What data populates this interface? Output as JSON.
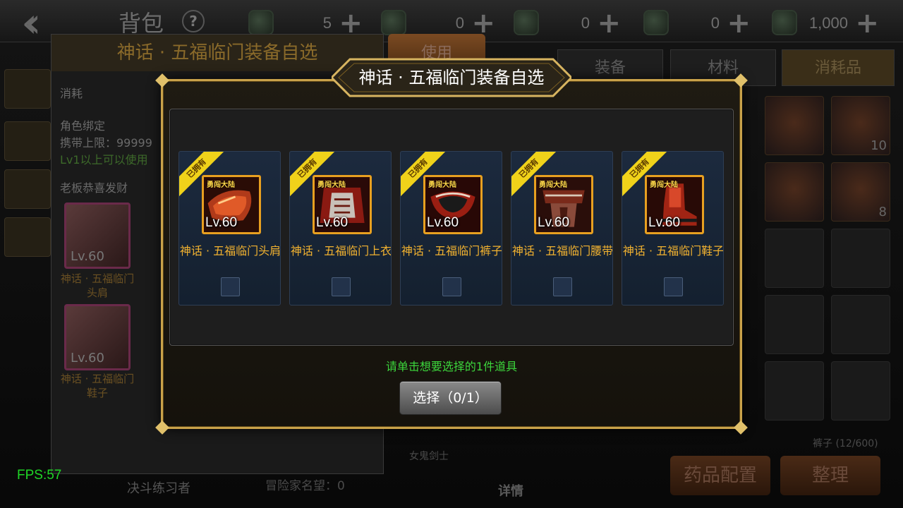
{
  "header": {
    "title": "背包",
    "back_icon": "double-chevron-left-icon",
    "help_label": "?",
    "currencies": [
      {
        "icon": "coin-medal-icon",
        "value": "5"
      },
      {
        "icon": "green-crystal-icon",
        "value": "0"
      },
      {
        "icon": "teal-potion-icon",
        "value": "0"
      },
      {
        "icon": "gold-coin-icon",
        "value": "0"
      },
      {
        "icon": "gold-pile-icon",
        "value": "1,000"
      }
    ],
    "plus_label": "+"
  },
  "detail_panel": {
    "title": "神话 · 五福临门装备自选",
    "type": "消耗",
    "bind": "角色绑定",
    "carry_limit": "携带上限：99999",
    "level_req": "Lv1以上可以使用",
    "desc": "老板恭喜发财",
    "items": [
      {
        "lv": "Lv.60",
        "name": "神话 · 五福临门头肩"
      },
      {
        "lv": "Lv.60",
        "name": "神话 · 五福临门鞋子"
      }
    ],
    "use_label": "使用"
  },
  "inventory": {
    "tabs": [
      {
        "label": "装备",
        "active": false
      },
      {
        "label": "材料",
        "active": false
      },
      {
        "label": "消耗品",
        "active": true
      }
    ],
    "counts": [
      "10",
      "8"
    ],
    "slot_text": "裤子 (12/600)",
    "char_label": "女鬼剑士",
    "detail_label": "详情",
    "fame_label": "冒险家名望：0",
    "duel_label": "决斗练习者",
    "med_config_label": "药品配置",
    "sort_label": "整理"
  },
  "fps": "FPS:57",
  "modal": {
    "title": "神话 · 五福临门装备自选",
    "ribbon_label": "已拥有",
    "brand_label": "勇闯大陆",
    "items": [
      {
        "lv": "Lv.60",
        "name": "神话 · 五福临门头肩",
        "checked": false,
        "art": "shoulder"
      },
      {
        "lv": "Lv.60",
        "name": "神话 · 五福临门上衣",
        "checked": false,
        "art": "top"
      },
      {
        "lv": "Lv.60",
        "name": "神话 · 五福临门裤子",
        "checked": false,
        "art": "pants"
      },
      {
        "lv": "Lv.60",
        "name": "神话 · 五福临门腰带",
        "checked": false,
        "art": "belt"
      },
      {
        "lv": "Lv.60",
        "name": "神话 · 五福临门鞋子",
        "checked": false,
        "art": "shoes"
      }
    ],
    "hint": "请单击想要选择的1件道具",
    "select_button": "选择（0/1）"
  }
}
